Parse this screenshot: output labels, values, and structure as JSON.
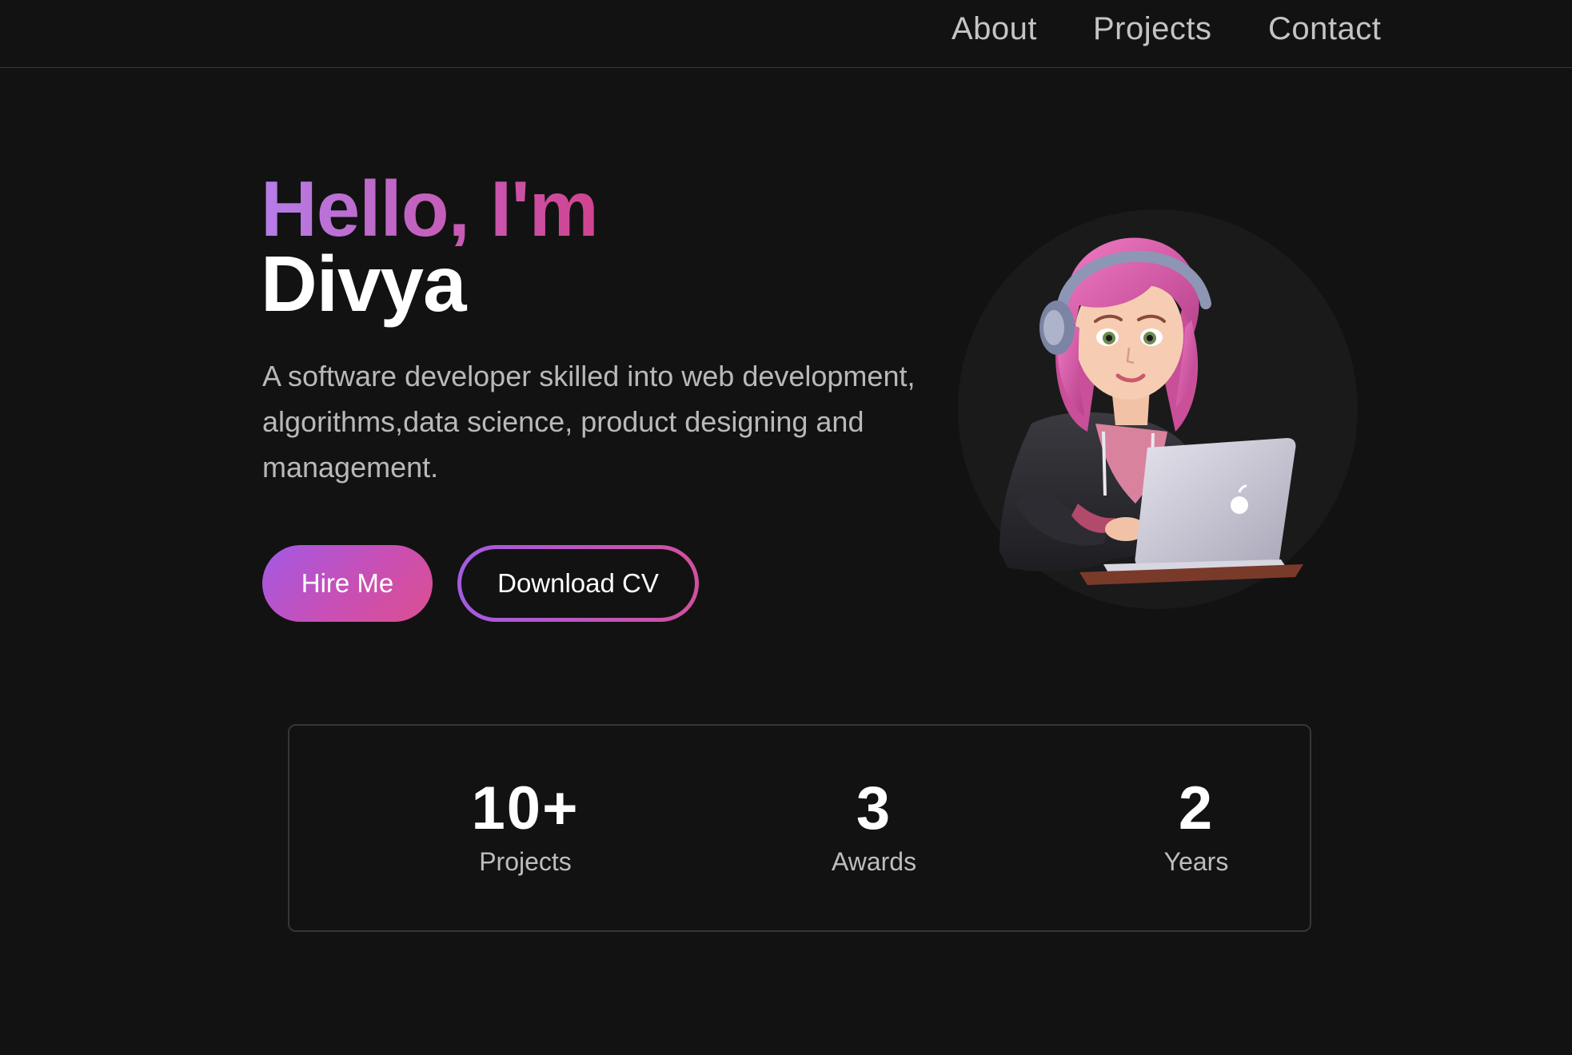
{
  "nav": {
    "items": [
      {
        "label": "About"
      },
      {
        "label": "Projects"
      },
      {
        "label": "Contact"
      }
    ]
  },
  "hero": {
    "greeting": "Hello, I'm",
    "name": "Divya",
    "bio": "A software developer skilled into web development, algorithms,data science, product designing and management.",
    "hire_label": "Hire Me",
    "cv_label": "Download CV",
    "avatar_icon": "developer-avatar-illustration"
  },
  "stats": [
    {
      "value": "10+",
      "label": "Projects"
    },
    {
      "value": "3",
      "label": "Awards"
    },
    {
      "value": "2",
      "label": "Years"
    }
  ],
  "colors": {
    "background": "#121212",
    "accent_start": "#a359e6",
    "accent_end": "#dc4f90",
    "text_primary": "#ffffff",
    "text_muted": "#b9b9b9"
  }
}
